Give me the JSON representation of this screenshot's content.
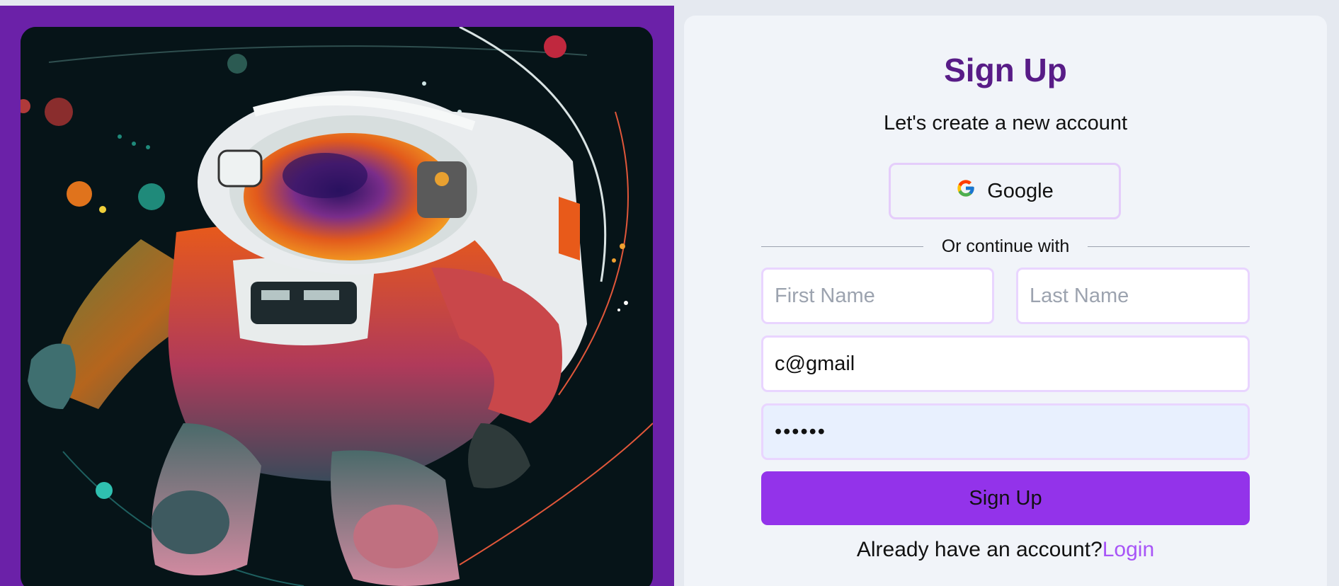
{
  "form": {
    "title": "Sign Up",
    "subtitle": "Let's create a new account",
    "google_label": "Google",
    "divider_text": "Or continue with",
    "first_name": {
      "value": "",
      "placeholder": "First Name"
    },
    "last_name": {
      "value": "",
      "placeholder": "Last Name"
    },
    "email": {
      "value": "c@gmail",
      "placeholder": ""
    },
    "password": {
      "value": "••••••",
      "placeholder": ""
    },
    "submit_label": "Sign Up",
    "login_prompt": "Already have an account?",
    "login_link": "Login"
  },
  "icons": {
    "google": "google-logo-icon"
  },
  "colors": {
    "left_panel": "#6b21a8",
    "title": "#581c87",
    "submit": "#9333ea",
    "login_link": "#a855f7",
    "field_border": "#e9d5ff"
  }
}
